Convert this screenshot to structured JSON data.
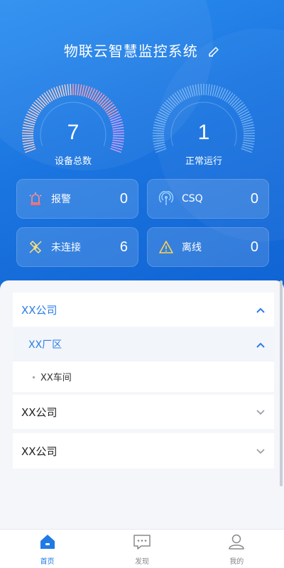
{
  "header": {
    "title": "物联云智慧监控系统"
  },
  "gauges": [
    {
      "value": "7",
      "label": "设备总数"
    },
    {
      "value": "1",
      "label": "正常运行"
    }
  ],
  "stats": {
    "alarm": {
      "label": "报警",
      "value": "0"
    },
    "csq": {
      "label": "CSQ",
      "value": "0"
    },
    "disconnected": {
      "label": "未连接",
      "value": "6"
    },
    "offline": {
      "label": "离线",
      "value": "0"
    }
  },
  "tree": {
    "company1": "XX公司",
    "factory": "XX厂区",
    "workshop": "XX车间",
    "company2": "XX公司",
    "company3": "XX公司"
  },
  "tabs": [
    {
      "label": "首页",
      "icon": "home-icon"
    },
    {
      "label": "发现",
      "icon": "chat-icon"
    },
    {
      "label": "我的",
      "icon": "user-icon"
    }
  ],
  "colors": {
    "accent": "#1f7ae6",
    "hero": "#1b75e0"
  }
}
